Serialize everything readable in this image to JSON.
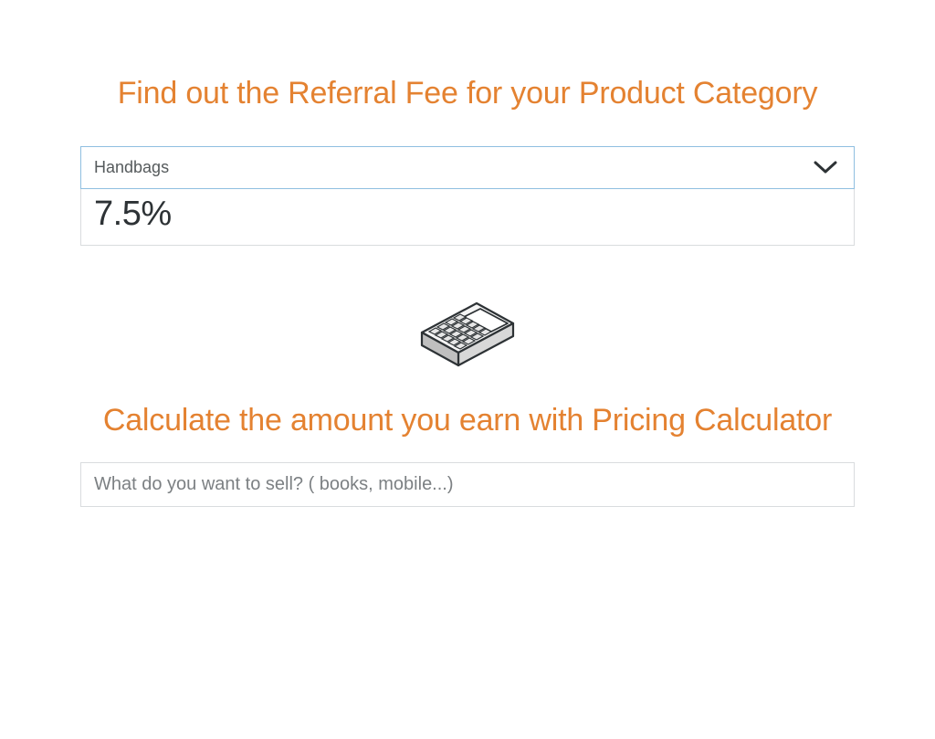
{
  "colors": {
    "accent": "#e48231",
    "selectBorder": "#8fbfe0",
    "boxBorder": "#d9dcde",
    "textDark": "#2d3235",
    "textMuted": "#7c8083"
  },
  "referral": {
    "heading": "Find out the Referral Fee for your Product Category",
    "selected": "Handbags",
    "fee": "7.5%"
  },
  "calculator": {
    "heading": "Calculate the amount you earn with Pricing Calculator",
    "placeholder": "What do you want to sell? ( books, mobile...)",
    "icon": "calculator-icon"
  }
}
